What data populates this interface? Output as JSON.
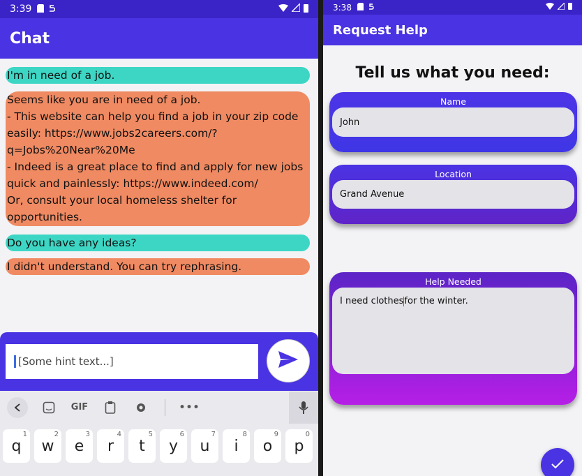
{
  "left": {
    "status": {
      "time": "3:39",
      "icons": [
        "sd-card-icon",
        "s-notification-icon"
      ]
    },
    "title": "Chat",
    "messages": [
      {
        "from": "user",
        "text": "I'm in need of a job."
      },
      {
        "from": "bot",
        "text": "Seems like you are in need of a job.\n- This website can help you find a job in your zip code easily: https://www.jobs2careers.com/?q=Jobs%20Near%20Me\n- Indeed is a great place to find and apply for new jobs quick and painlessly: https://www.indeed.com/\nOr, consult your local homeless shelter for opportunities."
      },
      {
        "from": "user",
        "text": "Do you have any ideas?"
      },
      {
        "from": "bot",
        "text": "I didn't understand. You can try rephrasing."
      }
    ],
    "composer": {
      "hint": "[Some hint text...]"
    },
    "keyboard": {
      "toolbar": [
        "chevron-left-icon",
        "sticker-icon",
        "GIF",
        "clipboard-icon",
        "gear-icon",
        "more-icon",
        "mic-icon"
      ],
      "gif_label": "GIF",
      "more_label": "•••",
      "keys": [
        {
          "letter": "q",
          "num": "1"
        },
        {
          "letter": "w",
          "num": "2"
        },
        {
          "letter": "e",
          "num": "3"
        },
        {
          "letter": "r",
          "num": "4"
        },
        {
          "letter": "t",
          "num": "5"
        },
        {
          "letter": "y",
          "num": "6"
        },
        {
          "letter": "u",
          "num": "7"
        },
        {
          "letter": "i",
          "num": "8"
        },
        {
          "letter": "o",
          "num": "9"
        },
        {
          "letter": "p",
          "num": "0"
        }
      ]
    }
  },
  "right": {
    "status": {
      "time": "3:38"
    },
    "title": "Request Help",
    "heading": "Tell us what you need:",
    "fields": [
      {
        "label": "Name",
        "value": "John"
      },
      {
        "label": "Location",
        "value": "Grand Avenue"
      },
      {
        "label": "Help Needed",
        "value_before_caret": "I need clothes",
        "value_after_caret": "for the winter."
      }
    ]
  },
  "colors": {
    "primary": "#4a33e3",
    "user_bubble": "#3dd6c4",
    "bot_bubble": "#f08a62"
  }
}
